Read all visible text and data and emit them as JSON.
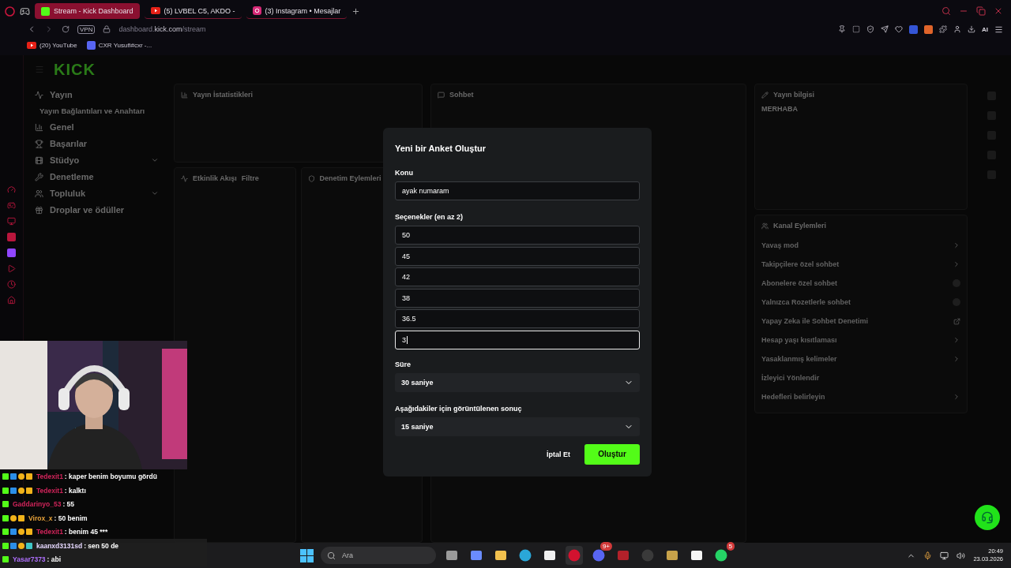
{
  "browser": {
    "tabs": [
      {
        "kind": "kick",
        "title": "Stream - Kick Dashboard",
        "selected": true
      },
      {
        "kind": "youtube",
        "title": "(5) LVBEL C5, AKDO -",
        "selected": false
      },
      {
        "kind": "instagram",
        "title": "(3) Instagram • Mesajlar",
        "selected": false
      }
    ],
    "vpn": "VPN",
    "url_host": "dashboard.",
    "url_domain": "kick.com",
    "url_path": "/stream",
    "ai": "AI",
    "bookmarks": [
      {
        "kind": "youtube",
        "title": "(20) YouTube"
      },
      {
        "kind": "discord",
        "title": "CXR Yusufi#cxr -..."
      }
    ]
  },
  "dashboard": {
    "logo": "KICK",
    "nav": [
      {
        "kind": "heading",
        "label": "Yayın",
        "expandable": false
      },
      {
        "kind": "sub",
        "label": "Yayın Bağlantıları ve Anahtarı",
        "expandable": false
      },
      {
        "kind": "item",
        "label": "Genel",
        "expandable": false
      },
      {
        "kind": "item",
        "label": "Başarılar",
        "expandable": false
      },
      {
        "kind": "item",
        "label": "Stüdyo",
        "expandable": true
      },
      {
        "kind": "item",
        "label": "Denetleme",
        "expandable": false
      },
      {
        "kind": "item",
        "label": "Topluluk",
        "expandable": true
      },
      {
        "kind": "item",
        "label": "Droplar ve ödüller",
        "expandable": false
      }
    ],
    "stats_title": "Yayın İstatistikleri",
    "events_title": "Etkinlik Akışı",
    "events_filter": "Filtre",
    "moderation_title": "Denetim Eylemleri",
    "chat_title": "Sohbet",
    "info_title": "Yayın bilgisi",
    "info_heading": "MERHABA",
    "actions_title": "Kanal Eylemleri",
    "actions": [
      {
        "label": "Yavaş mod",
        "kind": "link"
      },
      {
        "label": "Takipçilere özel sohbet",
        "kind": "link"
      },
      {
        "label": "Abonelere özel sohbet",
        "kind": "toggle"
      },
      {
        "label": "Yalnızca Rozetlerle sohbet",
        "kind": "toggle"
      },
      {
        "label": "Yapay Zeka ile Sohbet Denetimi",
        "kind": "external"
      },
      {
        "label": "Hesap yaşı kısıtlaması",
        "kind": "link"
      },
      {
        "label": "Yasaklanmış kelimeler",
        "kind": "link"
      },
      {
        "label": "İzleyici Yönlendir",
        "kind": "plain"
      },
      {
        "label": "Hedefleri belirleyin",
        "kind": "link"
      }
    ]
  },
  "poll_dialog": {
    "title": "Yeni bir Anket Oluştur",
    "topic_label": "Konu",
    "topic_value": "ayak numaram",
    "options_label": "Seçenekler (en az 2)",
    "options": [
      {
        "value": "50",
        "focused": false
      },
      {
        "value": "45",
        "focused": false
      },
      {
        "value": "42",
        "focused": false
      },
      {
        "value": "38",
        "focused": false
      },
      {
        "value": "36.5",
        "focused": false
      },
      {
        "value": "3",
        "focused": true
      }
    ],
    "duration_label": "Süre",
    "duration_value": "30 saniye",
    "result_label": "Aşağıdakiler için görüntülenen sonuç",
    "result_value": "15 saniye",
    "cancel": "İptal Et",
    "submit": "Oluştur"
  },
  "chat_overlay": [
    {
      "user": "Tedexit1",
      "color": "#d0245a",
      "text": ": kaper benim boyumu gördü",
      "badges": [
        {
          "kind": "kick"
        },
        {
          "kind": "mod"
        },
        {
          "kind": "gift"
        },
        {
          "kind": "crown"
        }
      ]
    },
    {
      "user": "Tedexit1",
      "color": "#d0245a",
      "text": ": kalktı",
      "badges": [
        {
          "kind": "kick"
        },
        {
          "kind": "mod"
        },
        {
          "kind": "gift"
        },
        {
          "kind": "crown"
        }
      ]
    },
    {
      "user": "Gaddarinyo_53",
      "color": "#d0245a",
      "text": ": 55",
      "badges": [
        {
          "kind": "kick"
        }
      ]
    },
    {
      "user": "Virox_x",
      "color": "#e8a33a",
      "text": ": 50 benim",
      "badges": [
        {
          "kind": "kick"
        },
        {
          "kind": "gift"
        },
        {
          "kind": "crown"
        }
      ]
    },
    {
      "user": "Tedexit1",
      "color": "#d0245a",
      "text": ": benim 45 ***",
      "badges": [
        {
          "kind": "kick"
        },
        {
          "kind": "mod"
        },
        {
          "kind": "gift"
        },
        {
          "kind": "crown"
        }
      ]
    },
    {
      "user": "kaanxd3131sd",
      "color": "#e6d8ff",
      "text": ": sen 50 de",
      "badges": [
        {
          "kind": "kick"
        },
        {
          "kind": "mod"
        },
        {
          "kind": "gift"
        },
        {
          "kind": "sub"
        }
      ]
    },
    {
      "user": "Yasar7373",
      "color": "#b070ff",
      "text": ": abi",
      "badges": [
        {
          "kind": "kick"
        }
      ]
    }
  ],
  "taskbar": {
    "search_placeholder": "Ara",
    "apps": [
      {
        "kind": "taskview"
      },
      {
        "kind": "copilot"
      },
      {
        "kind": "folder"
      },
      {
        "kind": "edge"
      },
      {
        "kind": "store"
      },
      {
        "kind": "opera",
        "selected": true
      },
      {
        "kind": "discord",
        "badge": "9+"
      },
      {
        "kind": "voicemeeter"
      },
      {
        "kind": "obs"
      },
      {
        "kind": "league"
      },
      {
        "kind": "capcut"
      },
      {
        "kind": "whatsapp",
        "badge": "5"
      }
    ],
    "time": "20:49",
    "date": "23.03.2026"
  }
}
